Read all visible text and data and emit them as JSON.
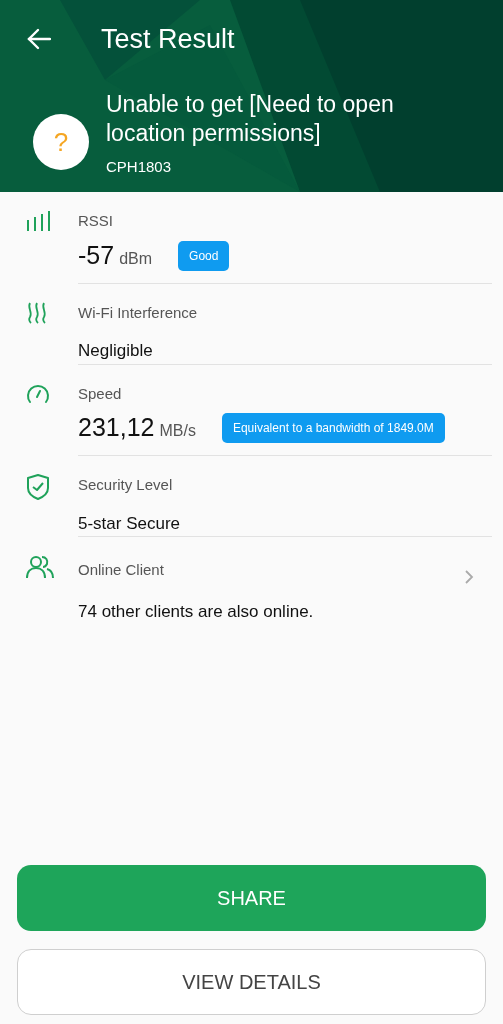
{
  "header": {
    "title": "Test Result",
    "status_text": "Unable to get [Need to open location permissions]",
    "device": "CPH1803",
    "status_icon": "?"
  },
  "results": [
    {
      "kind": "measure",
      "label": "RSSI",
      "value": "-57",
      "unit": "dBm",
      "badge": "Good"
    },
    {
      "kind": "text",
      "label": "Wi-Fi Interference",
      "value": "Negligible"
    },
    {
      "kind": "measure",
      "label": "Speed",
      "value": "231,12",
      "unit": "MB/s",
      "badge": "Equivalent to a bandwidth of 1849.0M"
    },
    {
      "kind": "text",
      "label": "Security Level",
      "value": "5-star Secure"
    },
    {
      "kind": "link",
      "label": "Online Client",
      "value": "74 other clients are also online."
    }
  ],
  "buttons": [
    {
      "kind": "primary",
      "label": "SHARE"
    },
    {
      "kind": "secondary",
      "label": "VIEW DETAILS"
    }
  ]
}
